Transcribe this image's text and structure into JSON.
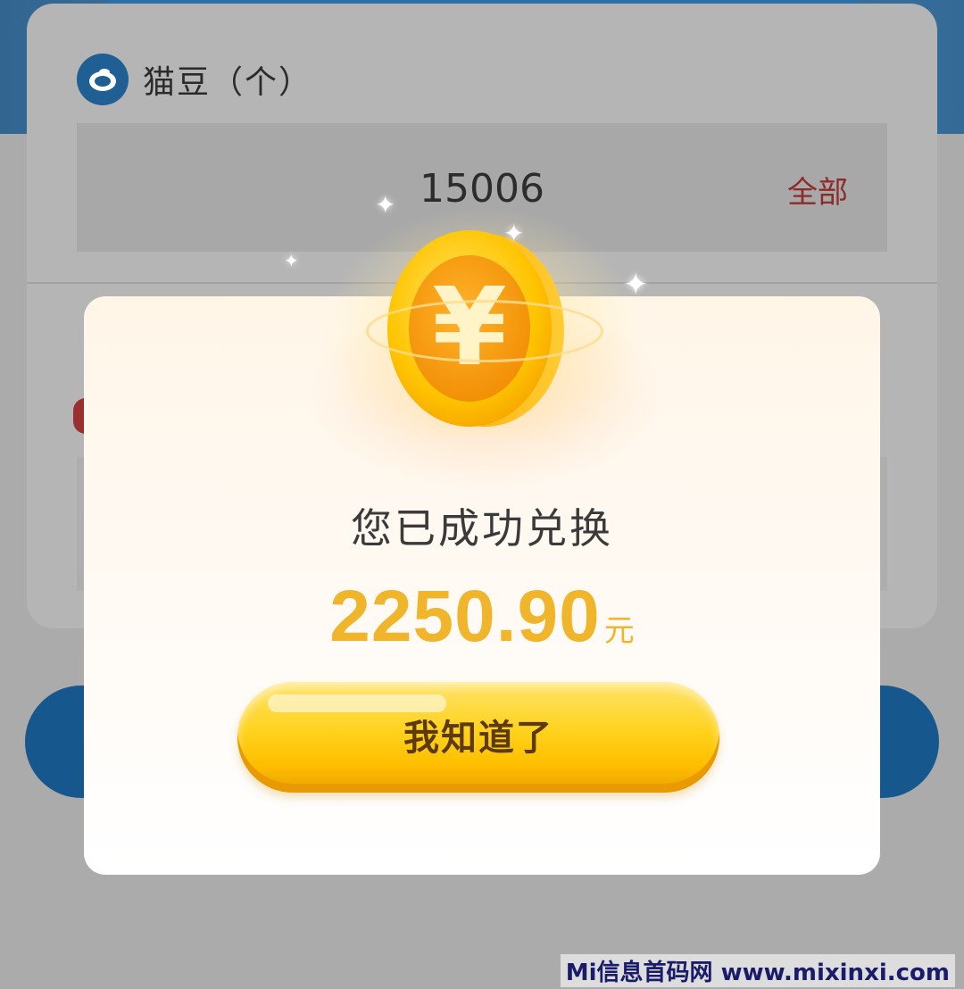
{
  "background": {
    "card_title": "猫豆（个）",
    "amount_value": "15006",
    "all_link": "全部"
  },
  "modal": {
    "message": "您已成功兑换",
    "amount": "2250.90",
    "unit": "元",
    "confirm_label": "我知道了",
    "coin_symbol": "¥"
  },
  "watermark": "Mi信息首码网 www.mixinxi.com",
  "icons": {
    "bean": "bean-icon",
    "coin": "yuan-coin-icon",
    "sparkle": "sparkle-icon"
  },
  "colors": {
    "brand_blue": "#1f5f94",
    "amount_gold": "#f0b52a",
    "link_red": "#8e2a2a",
    "button_yellow": "#ffd21c"
  }
}
